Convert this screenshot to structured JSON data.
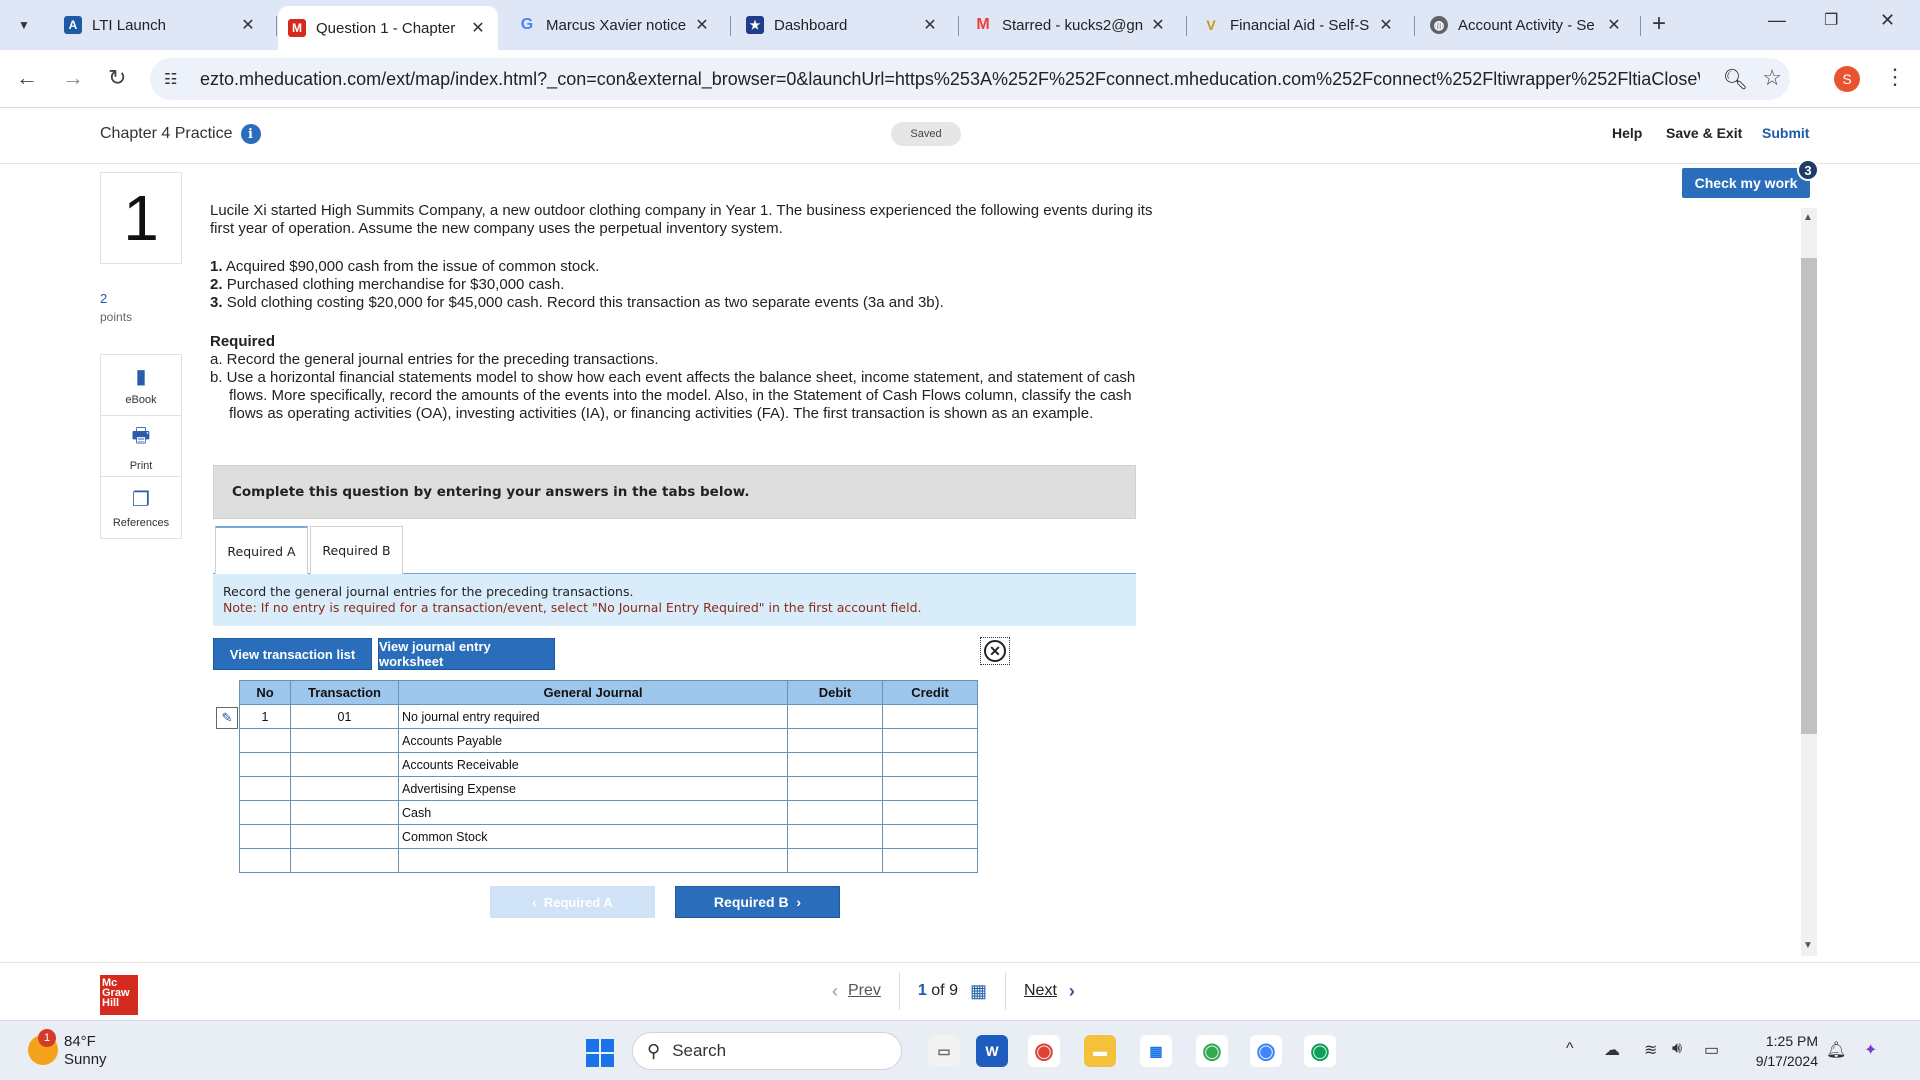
{
  "browser": {
    "tabs": [
      {
        "title": "LTI Launch",
        "favicon": "mheducation-a-icon",
        "active": false
      },
      {
        "title": "Question 1 - Chapter",
        "favicon": "mcgraw-m-icon",
        "active": true
      },
      {
        "title": "Marcus Xavier notice",
        "favicon": "google-g-icon",
        "active": false
      },
      {
        "title": "Dashboard",
        "favicon": "star-badge-icon",
        "active": false
      },
      {
        "title": "Starred - kucks2@gn",
        "favicon": "gmail-icon",
        "active": false
      },
      {
        "title": "Financial Aid - Self-S",
        "favicon": "university-icon",
        "active": false
      },
      {
        "title": "Account Activity - Se",
        "favicon": "globe-icon",
        "active": false
      }
    ],
    "url": "ezto.mheducation.com/ext/map/index.html?_con=con&external_browser=0&launchUrl=https%253A%252F%252Fconnect.mheducation.com%252Fconnect%252Fltiwrapper%252FltiaCloseWindow....",
    "profile_initial": "S"
  },
  "header": {
    "chapter_title": "Chapter 4 Practice",
    "saved_label": "Saved",
    "help_label": "Help",
    "save_exit_label": "Save & Exit",
    "submit_label": "Submit"
  },
  "question": {
    "number": "1",
    "points_value": "2",
    "points_label": "points",
    "check_work_label": "Check my work",
    "check_work_badge": "3",
    "intro": "Lucile Xi started High Summits Company, a new outdoor clothing company in Year 1. The business experienced the following events during its first year of operation. Assume the new company uses the perpetual inventory system.",
    "events": [
      {
        "num": "1.",
        "text": "Acquired $90,000 cash from the issue of common stock."
      },
      {
        "num": "2.",
        "text": "Purchased clothing merchandise for $30,000 cash."
      },
      {
        "num": "3.",
        "text": "Sold clothing costing $20,000 for $45,000 cash. Record this transaction as two separate events (3a and 3b)."
      }
    ],
    "required_title": "Required",
    "required_a": "a. Record the general journal entries for the preceding transactions.",
    "required_b": "b. Use a horizontal financial statements model to show how each event affects the balance sheet, income statement, and statement of cash flows. More specifically, record the amounts of the events into the model. Also, in the Statement of Cash Flows column, classify the cash flows as operating activities (OA), investing activities (IA), or financing activities (FA). The first transaction is shown as an example.",
    "complete_prompt": "Complete this question by entering your answers in the tabs below.",
    "tabs": [
      "Required A",
      "Required B"
    ],
    "instruction": "Record the general journal entries for the preceding transactions.",
    "note": "Note: If no entry is required for a transaction/event, select \"No Journal Entry Required\" in the first account field.",
    "btn_transaction_list": "View transaction list",
    "btn_journal_worksheet": "View journal entry worksheet"
  },
  "tools": [
    {
      "label": "eBook",
      "icon": "book-icon"
    },
    {
      "label": "Print",
      "icon": "printer-icon"
    },
    {
      "label": "References",
      "icon": "documents-icon"
    }
  ],
  "journal": {
    "headers": [
      "No",
      "Transaction",
      "General Journal",
      "Debit",
      "Credit"
    ],
    "rows": [
      {
        "no": "1",
        "tx": "01",
        "account": "No journal entry required",
        "debit": "",
        "credit": ""
      },
      {
        "no": "",
        "tx": "",
        "account": "Accounts Payable",
        "debit": "",
        "credit": ""
      },
      {
        "no": "",
        "tx": "",
        "account": "Accounts Receivable",
        "debit": "",
        "credit": ""
      },
      {
        "no": "",
        "tx": "",
        "account": "Advertising Expense",
        "debit": "",
        "credit": ""
      },
      {
        "no": "",
        "tx": "",
        "account": "Cash",
        "debit": "",
        "credit": ""
      },
      {
        "no": "",
        "tx": "",
        "account": "Common Stock",
        "debit": "",
        "credit": ""
      },
      {
        "no": "",
        "tx": "",
        "account": "",
        "debit": "",
        "credit": ""
      }
    ]
  },
  "req_nav": {
    "prev_label": "Required A",
    "next_label": "Required B"
  },
  "footer": {
    "logo_lines": [
      "Mc",
      "Graw",
      "Hill"
    ],
    "prev_label": "Prev",
    "current_page": "1",
    "of_label": "of",
    "total_pages": "9",
    "next_label": "Next"
  },
  "taskbar": {
    "weather_badge": "1",
    "temperature": "84°F",
    "condition": "Sunny",
    "search_label": "Search",
    "time": "1:25 PM",
    "date": "9/17/2024"
  },
  "colors": {
    "accent_blue": "#2a6ebb",
    "journal_header": "#9cc6ec",
    "instruction_bg": "#d9ecfa",
    "brand_red": "#d52b1e"
  }
}
